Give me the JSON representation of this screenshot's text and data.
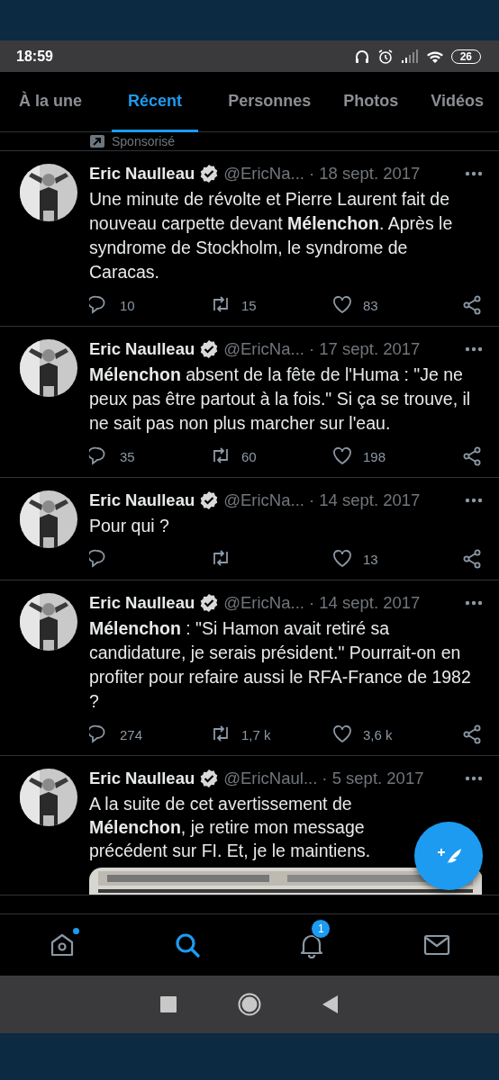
{
  "status_bar": {
    "time": "18:59",
    "battery": "26"
  },
  "tabs": [
    {
      "label": "À la une",
      "selected": false
    },
    {
      "label": "Récent",
      "selected": true
    },
    {
      "label": "Personnes",
      "selected": false
    },
    {
      "label": "Photos",
      "selected": false
    },
    {
      "label": "Vidéos",
      "selected": false
    }
  ],
  "promoted": {
    "label": "Sponsorisé"
  },
  "tweets": [
    {
      "name": "Eric Naulleau",
      "verified": true,
      "handle": "@EricNa...",
      "date": "· 18 sept. 2017",
      "text": "Une minute de révolte et Pierre Laurent fait de nouveau carpette devant **Mélenchon**. Après le syndrome de Stockholm, le syndrome de Caracas.",
      "replies": "10",
      "retweets": "15",
      "likes": "83"
    },
    {
      "name": "Eric Naulleau",
      "verified": true,
      "handle": "@EricNa...",
      "date": "· 17 sept. 2017",
      "text": "**Mélenchon** absent de la fête de l'Huma : \"Je ne peux pas être partout à la fois.\" Si ça se trouve, il ne sait pas non plus marcher sur l'eau.",
      "replies": "35",
      "retweets": "60",
      "likes": "198"
    },
    {
      "name": "Eric Naulleau",
      "verified": true,
      "handle": "@EricNa...",
      "date": "· 14 sept. 2017",
      "text": "Pour qui ?",
      "likes": "13"
    },
    {
      "name": "Eric Naulleau",
      "verified": true,
      "handle": "@EricNa...",
      "date": "· 14 sept. 2017",
      "text": "**Mélenchon** : \"Si Hamon avait retiré sa candidature, je serais président.\" Pourrait-on en profiter pour refaire aussi le RFA-France de 1982 ?",
      "replies": "274",
      "retweets": "1,7 k",
      "likes": "3,6 k"
    },
    {
      "name": "Eric Naulleau",
      "verified": true,
      "handle": "@EricNaul...",
      "date": "· 5 sept. 2017",
      "text": "A la suite de cet avertissement de **Mélenchon**, je retire mon message précédent sur FI. Et, je le maintiens."
    }
  ],
  "bottom_nav": [
    {
      "kind": "home",
      "selected": false,
      "dot": true
    },
    {
      "kind": "search",
      "selected": true
    },
    {
      "kind": "notifications",
      "selected": false,
      "badge": "1"
    },
    {
      "kind": "messages",
      "selected": false
    }
  ]
}
